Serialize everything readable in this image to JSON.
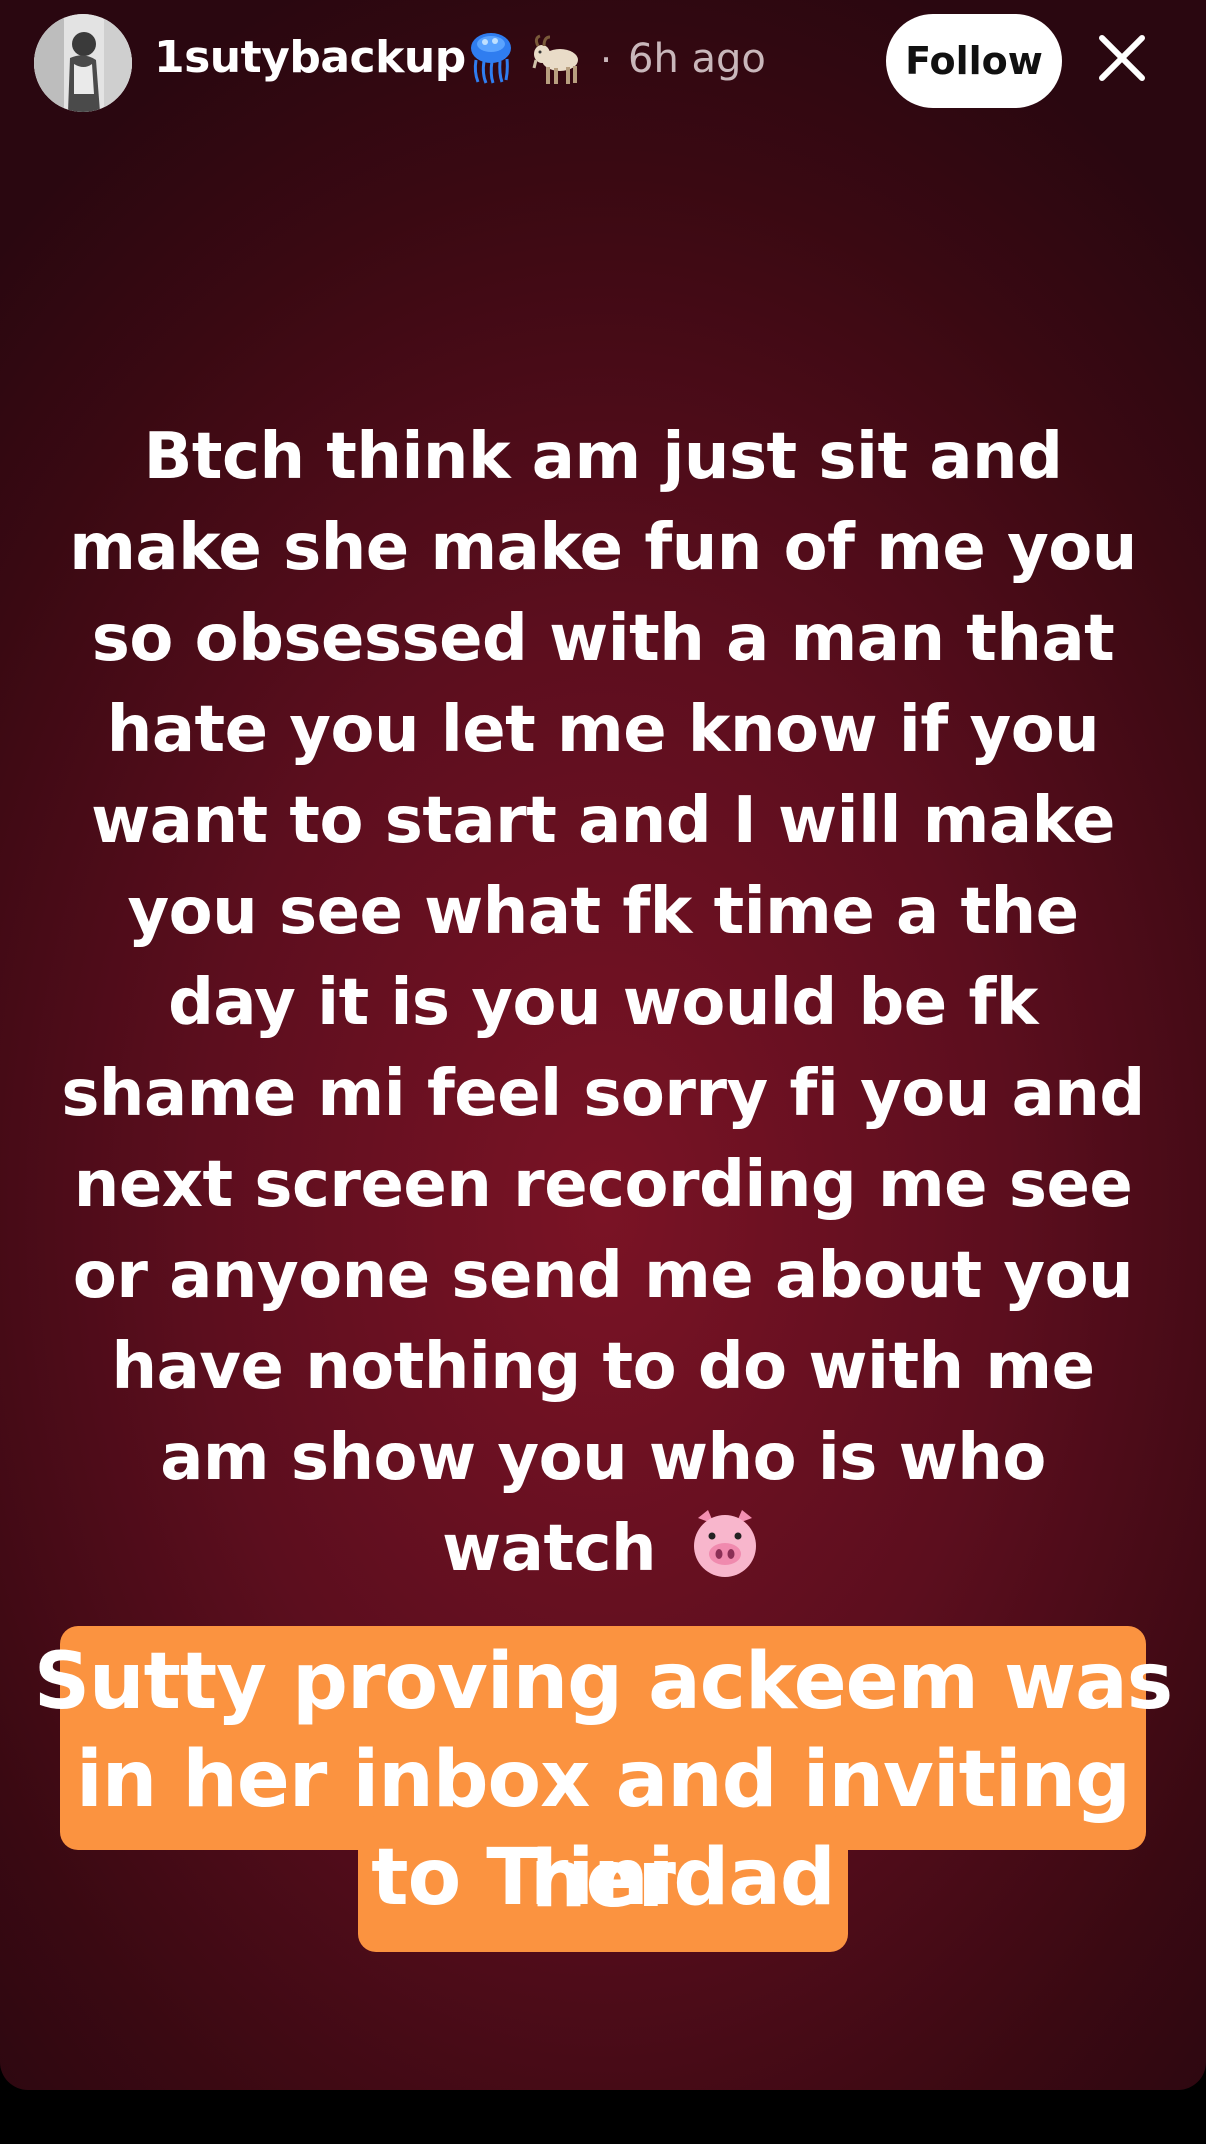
{
  "header": {
    "username": "1sutybackup",
    "badges": [
      "jellyfish-icon",
      "goat-icon"
    ],
    "separator": "·",
    "time_ago": "6h ago",
    "follow_label": "Follow",
    "close_label": "✕"
  },
  "story": {
    "text": "Btch think am just sit and make she make fun of me you so obsessed with a man that hate you let me know if you want to start and I will make you see what fk time a the day it is you would be fk shame mi feel sorry fi you and next screen recording me see or anyone send me about you have nothing to do with me am show you who is who watch",
    "text_lines": [
      "Btch think am just sit and",
      "make she make fun of me you",
      "so obsessed with a man that",
      "hate you let me know if you",
      "want to start and I will make",
      "you see what fk time a the",
      "day it is you would be fk",
      "shame mi feel sorry fi you and",
      "next screen recording me see",
      "or anyone send me about you",
      "have nothing to do with me",
      "am show you who is who",
      "watch"
    ],
    "trailing_emoji": "pig-face-icon"
  },
  "caption": {
    "lines": [
      "Sutty proving ackeem was",
      "in her inbox and inviting her",
      "to Trinidad"
    ],
    "background_color": "#fb9340"
  },
  "colors": {
    "background": "#6a1020",
    "text": "#ffffff",
    "follow_bg": "#ffffff"
  }
}
